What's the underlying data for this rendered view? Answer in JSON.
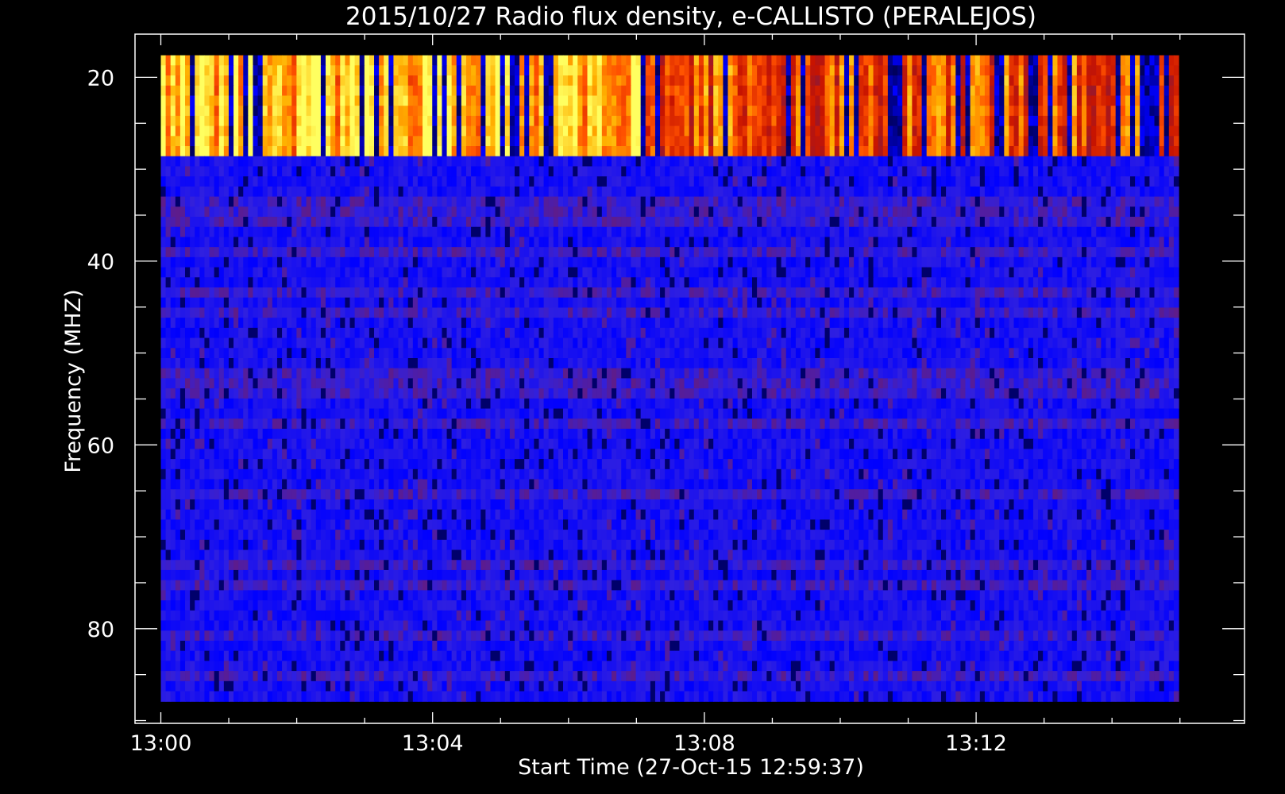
{
  "chart_data": {
    "type": "heatmap",
    "title": "2015/10/27  Radio flux density, e-CALLISTO (PERALEJOS)",
    "xlabel": "Start Time (27-Oct-15 12:59:37)",
    "ylabel": "Frequency (MHZ)",
    "x_start_time": "12:59:37",
    "xlim_minutes_after_1300": [
      -0.38,
      15.95
    ],
    "ylim_mhz": [
      15.3,
      90.3
    ],
    "y_inverted": true,
    "data_extent": {
      "time_minutes_after_1300": [
        0,
        14.98
      ],
      "frequency_mhz": [
        17.6,
        87.9
      ]
    },
    "x_ticks": [
      {
        "value": 0,
        "label": "13:00"
      },
      {
        "value": 4,
        "label": "13:04"
      },
      {
        "value": 8,
        "label": "13:08"
      },
      {
        "value": 12,
        "label": "13:12"
      }
    ],
    "x_minor_tick_step_minutes": 1,
    "y_ticks": [
      {
        "value": 20,
        "label": "20"
      },
      {
        "value": 40,
        "label": "40"
      },
      {
        "value": 60,
        "label": "60"
      },
      {
        "value": 80,
        "label": "80"
      }
    ],
    "y_minor_tick_step_mhz": 5,
    "colormap": [
      "#000000",
      "#0000ff",
      "#3020e0",
      "#8a1838",
      "#c81400",
      "#ff5000",
      "#ffb000",
      "#ffff60"
    ],
    "background_color": "#000000",
    "features": [
      {
        "frequency_range_mhz": [
          17.6,
          28.2
        ],
        "level": "high",
        "description_level": 0.85
      },
      {
        "frequency_range_mhz": [
          28.2,
          87.9
        ],
        "level": "low",
        "description_level": 0.2
      }
    ],
    "grid": false,
    "legend": "none"
  }
}
